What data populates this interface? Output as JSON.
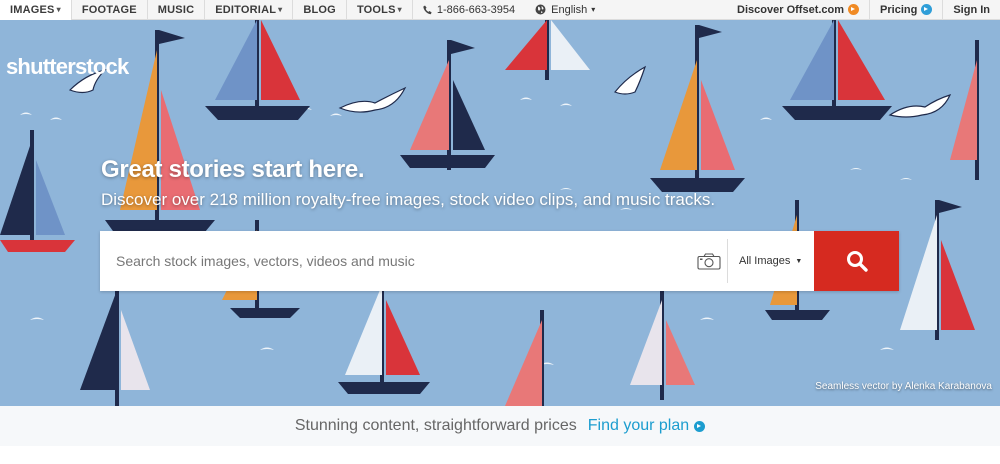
{
  "nav": {
    "items": [
      {
        "label": "IMAGES",
        "has_dropdown": true,
        "active": true
      },
      {
        "label": "FOOTAGE",
        "has_dropdown": false,
        "active": false
      },
      {
        "label": "MUSIC",
        "has_dropdown": false,
        "active": false
      },
      {
        "label": "EDITORIAL",
        "has_dropdown": true,
        "active": false
      },
      {
        "label": "BLOG",
        "has_dropdown": false,
        "active": false
      },
      {
        "label": "TOOLS",
        "has_dropdown": true,
        "active": false
      }
    ],
    "phone": "1-866-663-3954",
    "language": "English",
    "discover_offset": "Discover Offset.com",
    "pricing": "Pricing",
    "sign_in": "Sign In",
    "dropdown_caret": "▾"
  },
  "hero": {
    "logo": "shutterstock",
    "headline": "Great stories start here.",
    "subline": "Discover over 218 million royalty-free images, stock video clips, and music tracks.",
    "search": {
      "placeholder": "Search stock images, vectors, videos and music",
      "value": "",
      "type_selected": "All Images",
      "type_caret": "▼"
    },
    "credit": "Seamless vector by Alenka Karabanova"
  },
  "promo": {
    "text": "Stunning content, straightforward prices",
    "link": "Find your plan"
  },
  "icons": {
    "phone": "phone-icon",
    "globe": "globe-icon",
    "camera": "camera-icon",
    "search": "search-icon",
    "offset_arrow": "arrow-circle-icon"
  },
  "colors": {
    "accent_red": "#d62a20",
    "offset_orange": "#f08a24",
    "pricing_blue": "#2f9ed8",
    "link_blue": "#1c9dcf",
    "hero_bg": "#8fb5d9"
  }
}
